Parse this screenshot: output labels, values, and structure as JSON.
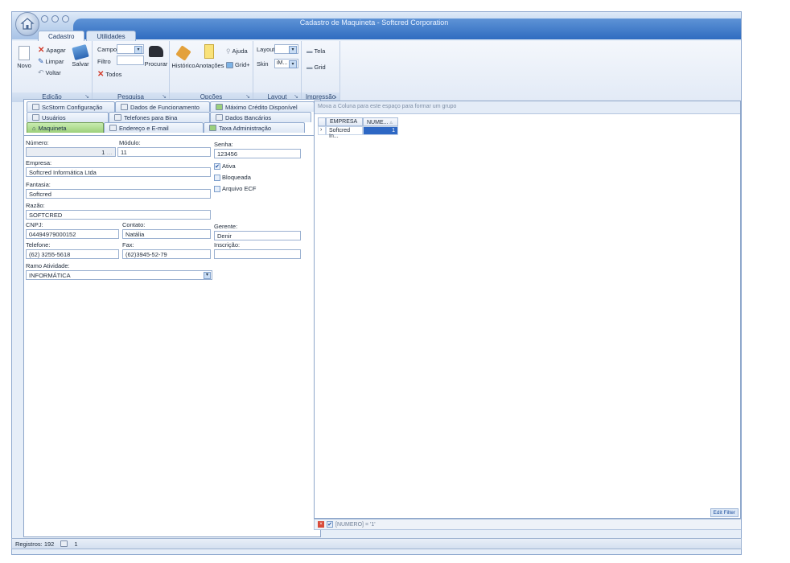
{
  "window": {
    "title": "Cadastro de Maquineta - Softcred Corporation"
  },
  "ribbon_tabs": [
    "Cadastro",
    "Utilidades"
  ],
  "ribbon": {
    "edicao": {
      "caption": "Edição",
      "novo": "Novo",
      "apagar": "Apagar",
      "limpar": "Limpar",
      "voltar": "Voltar",
      "salvar": "Salvar"
    },
    "pesquisa": {
      "caption": "Pesquisa",
      "campo": "Campo",
      "filtro": "Filtro",
      "todos": "Todos",
      "procurar": "Procurar"
    },
    "opcoes": {
      "caption": "Opções",
      "historico": "Histórico",
      "anotacoes": "Anotações",
      "ajuda": "Ajuda",
      "grid_plus": "Grid+"
    },
    "layout": {
      "caption": "Layout",
      "layout_label": "Layout",
      "skin_label": "Skin",
      "skin_value": "iM..."
    },
    "impressao": {
      "caption": "Impressão",
      "tela": "Tela",
      "grid": "Grid"
    }
  },
  "form_tabs": {
    "row1": [
      "ScStorm Configuração",
      "Dados de Funcionamento",
      "Máximo Crédito Disponível"
    ],
    "row2": [
      "Usuários",
      "Telefones para Bina",
      "Dados Bancários"
    ],
    "row3": [
      "Maquineta",
      "Endereço e E-mail",
      "Taxa Administração"
    ]
  },
  "form": {
    "numero_label": "Número:",
    "numero_value": "1",
    "modulo_label": "Módulo:",
    "modulo_value": "11",
    "senha_label": "Senha:",
    "senha_value": "123456",
    "empresa_label": "Empresa:",
    "empresa_value": "Softcred Informática Ltda",
    "ativa_label": "Ativa",
    "bloqueada_label": "Bloqueada",
    "arquivo_ecf_label": "Arquivo ECF",
    "fantasia_label": "Fantasia:",
    "fantasia_value": "Softcred",
    "razao_label": "Razão:",
    "razao_value": "SOFTCRED",
    "cnpj_label": "CNPJ:",
    "cnpj_value": "04494979000152",
    "contato_label": "Contato:",
    "contato_value": "Natália",
    "gerente_label": "Gerente:",
    "gerente_value": "Denir",
    "telefone_label": "Telefone:",
    "telefone_value": "(62) 3255-5618",
    "fax_label": "Fax:",
    "fax_value": "(62)3945-52-79",
    "inscricao_label": "Inscrição:",
    "inscricao_value": "",
    "ramo_label": "Ramo Atividade:",
    "ramo_value": "INFORMÁTICA"
  },
  "grid": {
    "group_hint": "Mova a Coluna para este espaço para formar um grupo",
    "columns": [
      "EMPRESA",
      "NUME..."
    ],
    "rows": [
      [
        "Softcred In...",
        "1"
      ]
    ],
    "filter_text": "[NUMERO] = '1'",
    "edit_filter": "Edit Filter"
  },
  "status": {
    "registros": "Registros: 192",
    "page": "1"
  }
}
